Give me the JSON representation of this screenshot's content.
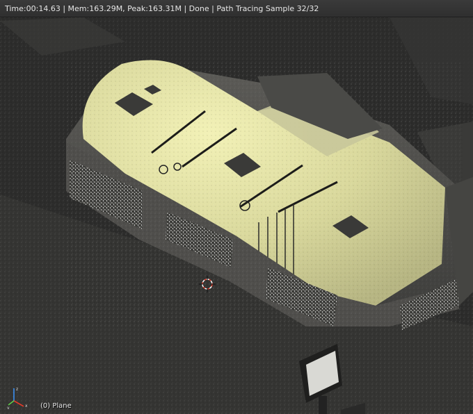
{
  "status": {
    "text": "Time:00:14.63 | Mem:163.29M, Peak:163.31M | Done | Path Tracing Sample 32/32"
  },
  "viewport": {
    "active_object_label": "(0) Plane"
  },
  "icons": {
    "cursor": "3d-cursor-icon",
    "axes": "axes-gizmo-icon"
  },
  "colors": {
    "background": "#2b2b2b",
    "floor_lit": "#d9d8a0",
    "wall": "#4a4a47",
    "cursor_red": "#e23a2a"
  }
}
